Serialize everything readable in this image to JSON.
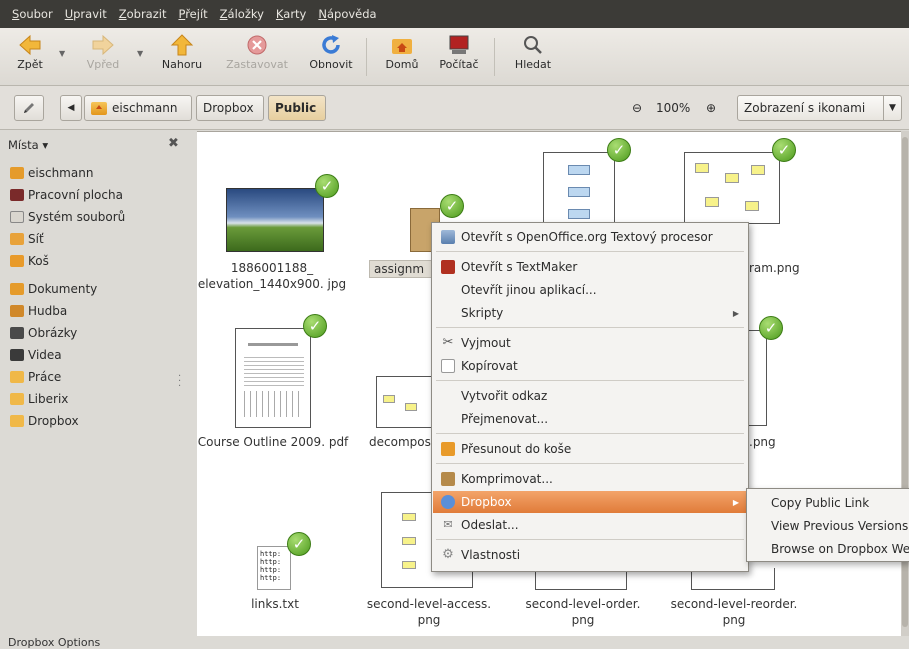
{
  "menubar": [
    "Soubor",
    "Upravit",
    "Zobrazit",
    "Přejít",
    "Záložky",
    "Karty",
    "Nápověda"
  ],
  "toolbar": {
    "back": "Zpět",
    "forward": "Vpřed",
    "up": "Nahoru",
    "stop": "Zastavovat",
    "reload": "Obnovit",
    "home": "Domů",
    "computer": "Počítač",
    "search": "Hledat"
  },
  "locbar": {
    "crumbs": [
      "eischmann",
      "Dropbox",
      "Public"
    ],
    "zoom": "100%",
    "view_mode": "Zobrazení s ikonami"
  },
  "sidebar": {
    "header": "Místa ▾",
    "items": [
      {
        "label": "eischmann",
        "icon": "home-folder-icon",
        "color": "#e59b2b"
      },
      {
        "label": "Pracovní plocha",
        "icon": "desktop-icon",
        "color": "#7a2a2a"
      },
      {
        "label": "Systém souborů",
        "icon": "drive-icon",
        "color": "#d9d6cf"
      },
      {
        "label": "Síť",
        "icon": "network-icon",
        "color": "#e8a23a"
      },
      {
        "label": "Koš",
        "icon": "trash-icon",
        "color": "#e89a2a"
      },
      {
        "label": "Dokumenty",
        "icon": "documents-folder-icon",
        "color": "#e59b2b"
      },
      {
        "label": "Hudba",
        "icon": "music-folder-icon",
        "color": "#d0882a"
      },
      {
        "label": "Obrázky",
        "icon": "pictures-folder-icon",
        "color": "#4a4a4a"
      },
      {
        "label": "Videa",
        "icon": "videos-folder-icon",
        "color": "#3a3a3a"
      },
      {
        "label": "Práce",
        "icon": "folder-icon",
        "color": "#f0b848"
      },
      {
        "label": "Liberix",
        "icon": "folder-icon",
        "color": "#f0b848"
      },
      {
        "label": "Dropbox",
        "icon": "folder-icon",
        "color": "#f0b848"
      }
    ]
  },
  "files": [
    {
      "name": "1886001188_ elevation_1440x900. jpg"
    },
    {
      "name": "assignm"
    },
    {
      "name": "ram.png"
    },
    {
      "name": "Course Outline 2009. pdf"
    },
    {
      "name": "decompos"
    },
    {
      "name": ".png"
    },
    {
      "name": "links.txt"
    },
    {
      "name": "second-level-access. png"
    },
    {
      "name": "second-level-order. png"
    },
    {
      "name": "second-level-reorder. png"
    }
  ],
  "context_menu": {
    "open_with_oo": "Otevřít s OpenOffice.org Textový procesor",
    "open_with_textmaker": "Otevřít s TextMaker",
    "open_other": "Otevřít jinou aplikací...",
    "scripts": "Skripty",
    "cut": "Vyjmout",
    "copy": "Kopírovat",
    "make_link": "Vytvořit odkaz",
    "rename": "Přejmenovat...",
    "move_trash": "Přesunout do koše",
    "compress": "Komprimovat...",
    "dropbox": "Dropbox",
    "send": "Odeslat...",
    "properties": "Vlastnosti"
  },
  "dropbox_submenu": [
    "Copy Public Link",
    "View Previous Versions",
    "Browse on Dropbox Website"
  ],
  "status": "Dropbox Options"
}
